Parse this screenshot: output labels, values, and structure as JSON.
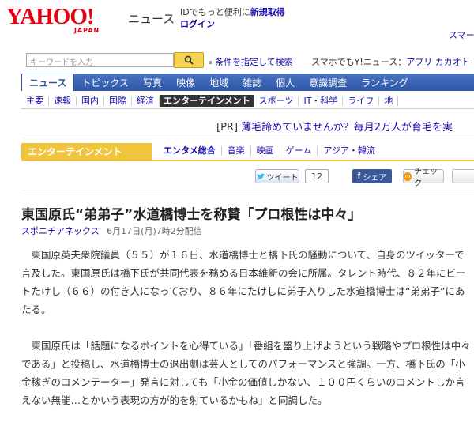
{
  "header": {
    "logo_text": "YAHOO!",
    "logo_sub": "JAPAN",
    "service_name": "ニュース",
    "promo_text": "IDでもっと便利に",
    "signup_link": "新規取得",
    "login_link": "ログイン",
    "right_link": "スマー"
  },
  "search": {
    "placeholder": "キーワードを入力",
    "condition_link": "条件を指定して検索",
    "mobile_promo": "スマホでもY!ニュース：",
    "mobile_links": "アプリ カカオト"
  },
  "global_nav": [
    "ニュース",
    "トピックス",
    "写真",
    "映像",
    "地域",
    "雑誌",
    "個人",
    "意識調査",
    "ランキング"
  ],
  "category_nav": [
    "主要",
    "速報",
    "国内",
    "国際",
    "経済",
    "エンターテインメント",
    "スポーツ",
    "IT・科学",
    "ライフ",
    "地"
  ],
  "pr": {
    "tag": "[PR]",
    "text": "薄毛諦めていませんか？毎月2万人が育毛を実"
  },
  "section": {
    "label": "エンターテインメント",
    "sub_nav": [
      "エンタメ総合",
      "音楽",
      "映画",
      "ゲーム",
      "アジア・韓流"
    ]
  },
  "social": {
    "tweet_label": "ツイート",
    "tweet_count": "12",
    "facebook_label": "シェア",
    "check_label": "チェック",
    "check_mark": "m",
    "facebook_icon": "f"
  },
  "article": {
    "headline": "東国原氏“弟弟子”水道橋博士を称賛「プロ根性は中々」",
    "source": "スポニチアネックス",
    "date": "6月17日(月)7時2分配信",
    "paragraphs": [
      "東国原英夫衆院議員（５５）が１６日、水道橋博士と橋下氏の騒動について、自身のツイッターで言及した。東国原氏は橋下氏が共同代表を務める日本維新の会に所属。タレント時代、８２年にビートたけし（６６）の付き人になっており、８６年にたけしに弟子入りした水道橋博士は“弟弟子”にあたる。",
      "東国原氏は「話題になるポイントを心得ている」「番組を盛り上げようという戦略やプロ根性は中々である」と投稿し、水道橋博士の退出劇は芸人としてのパフォーマンスと強調。一方、橋下氏の「小金稼ぎのコメンテーター」発言に対しても「小金の価値しかない、１００円くらいのコメントしか言えない無能…とかいう表現の方が的を射ているかもね」と同調した。"
    ]
  },
  "colors": {
    "brand_red": "#e60012",
    "nav_blue": "#2d56a6",
    "section_yellow": "#f0c53b",
    "link_blue": "#1a0dab",
    "facebook_blue": "#3b5998"
  },
  "icons": [
    "search-icon",
    "twitter-bird-icon",
    "facebook-icon",
    "check-icon"
  ]
}
